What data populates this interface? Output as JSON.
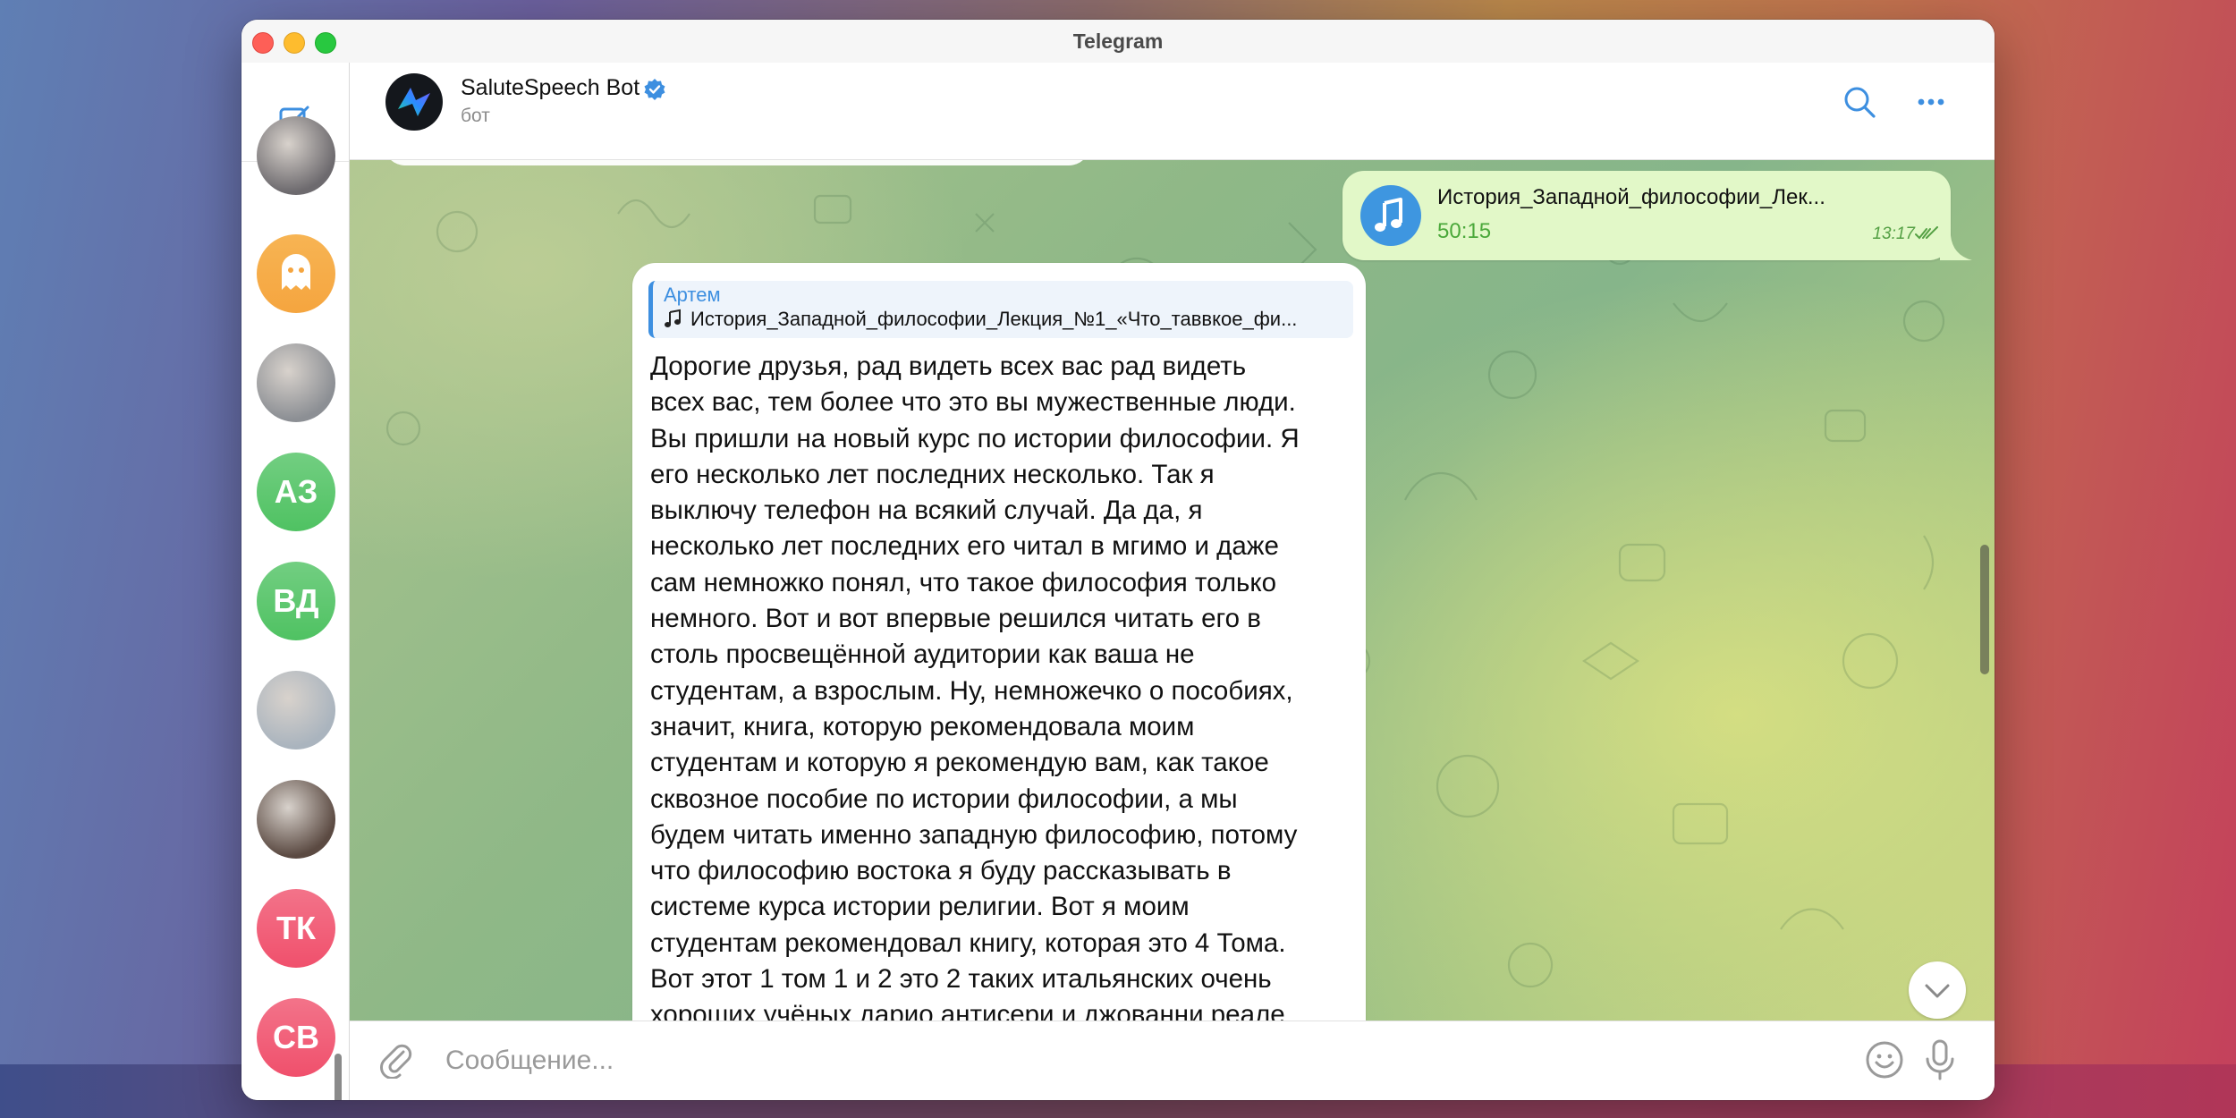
{
  "window": {
    "title": "Telegram"
  },
  "rail": {
    "compose_icon": "compose-icon",
    "chats": [
      {
        "type": "photo",
        "initials": "",
        "color": "#6d6a6e"
      },
      {
        "type": "ghost",
        "initials": "",
        "color": "#f5a53f"
      },
      {
        "type": "photo",
        "initials": "",
        "color": "#8c8f94"
      },
      {
        "type": "initials",
        "initials": "АЗ",
        "color": "#4fc262"
      },
      {
        "type": "initials",
        "initials": "ВД",
        "color": "#4fc262"
      },
      {
        "type": "photo",
        "initials": "",
        "color": "#aab4be"
      },
      {
        "type": "photo",
        "initials": "",
        "color": "#5b4a42"
      },
      {
        "type": "initials",
        "initials": "ТК",
        "color": "#f0506c"
      },
      {
        "type": "initials",
        "initials": "СВ",
        "color": "#f0506c"
      }
    ]
  },
  "header": {
    "name": "SaluteSpeech Bot",
    "status": "бот",
    "verified_icon": "verified-badge-icon",
    "search_icon": "search-icon",
    "more_icon": "more-icon"
  },
  "messages": {
    "outgoing": {
      "file_name": "История_Западной_философии_Лек...",
      "duration": "50:15",
      "time": "13:17",
      "status_icon": "double-check-icon"
    },
    "incoming": {
      "reply_author": "Артем",
      "reply_text": "История_Западной_философии_Лекция_№1_«Что_таввкое_фи...",
      "lines": [
        "Дорогие друзья, рад видеть всех вас рад видеть",
        "всех вас, тем более что это вы мужественные люди.",
        "Вы пришли на новый курс по истории философии. Я",
        "его несколько лет последних несколько. Так я",
        "выключу телефон на всякий случай. Да да, я",
        "несколько лет последних его читал в мгимо и даже",
        "сам немножко понял, что такое философия только",
        "немного. Вот и вот впервые решился читать его в",
        "столь просвещённой аудитории как ваша не",
        "студентам, а взрослым. Ну, немножечко о пособиях,",
        "значит, книга, которую рекомендовала моим",
        "студентам и которую я рекомендую вам, как такое",
        "сквозное пособие по истории философии, а мы",
        "будем читать именно западную философию, потому",
        "что философию востока я буду рассказывать в",
        "системе курса истории религии. Вот я моим",
        "студентам рекомендовал книгу, которая это 4 Тома.",
        "Вот этот 1 том 1 и 2 это 2 таких итальянских очень",
        "хороших учёных дарио антисери и джованни реале"
      ]
    }
  },
  "input": {
    "placeholder": "Сообщение...",
    "value": "",
    "attach_icon": "paperclip-icon",
    "emoji_icon": "emoji-icon",
    "mic_icon": "microphone-icon"
  },
  "colors": {
    "accent": "#3d8fe0",
    "outgoing_bubble": "#e2f8c8",
    "outgoing_meta": "#54a044"
  }
}
